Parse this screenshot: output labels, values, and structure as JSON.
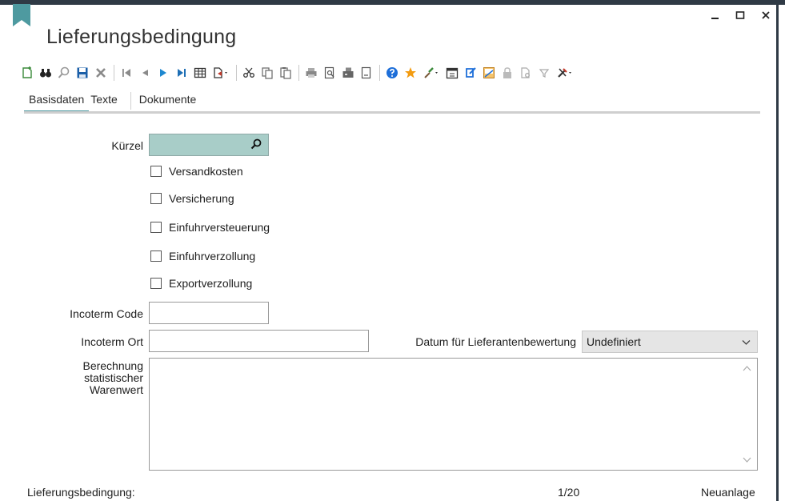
{
  "window": {
    "title": "Lieferungsbedingung",
    "controls": [
      "minimize-icon",
      "maximize-icon",
      "close-icon"
    ]
  },
  "toolbar": {
    "groups": [
      [
        "new-record-icon",
        "binoculars-icon",
        "search-icon",
        "save-icon",
        "delete-icon"
      ],
      [
        "first-record-icon",
        "previous-record-icon",
        "next-record-icon",
        "last-record-icon",
        "table-view-icon",
        "export-dropdown-icon"
      ],
      [
        "cut-icon",
        "copy-icon",
        "paste-icon"
      ],
      [
        "print-icon",
        "print-preview-icon",
        "fax-icon",
        "document-preview-icon"
      ],
      [
        "help-icon",
        "favorite-star-icon",
        "brush-dropdown-icon",
        "calendar-icon",
        "refresh-icon",
        "elo-archive-icon",
        "lock-icon",
        "document-settings-icon",
        "filter-icon",
        "tools-dropdown-icon"
      ]
    ]
  },
  "tabs": [
    {
      "label": "Basisdaten",
      "active": true
    },
    {
      "label": "Texte",
      "active": false
    },
    {
      "label": "Dokumente",
      "active": false
    }
  ],
  "form": {
    "kuerzel": {
      "label": "Kürzel",
      "value": ""
    },
    "checkboxes": [
      {
        "label": "Versandkosten",
        "checked": false
      },
      {
        "label": "Versicherung",
        "checked": false
      },
      {
        "label": "Einfuhrversteuerung",
        "checked": false
      },
      {
        "label": "Einfuhrverzollung",
        "checked": false
      },
      {
        "label": "Exportverzollung",
        "checked": false
      }
    ],
    "incoterm_code": {
      "label": "Incoterm Code",
      "value": ""
    },
    "incoterm_ort": {
      "label": "Incoterm Ort",
      "value": ""
    },
    "datum": {
      "label": "Datum für Lieferantenbewertung",
      "value": "Undefiniert"
    },
    "berechnung": {
      "label_lines": [
        "Berechnung",
        "statistischer",
        "Warenwert"
      ],
      "value": ""
    }
  },
  "status_bar": {
    "left": "Lieferungsbedingung:",
    "record": "1/20",
    "mode": "Neuanlage"
  },
  "colors": {
    "accent": "#4e9aa0",
    "kuerzel_field": "#a8cdc8",
    "frame": "#2f3a45",
    "play_blue": "#1e88d0",
    "help_blue": "#1e6fd9",
    "star_orange": "#f39c12"
  }
}
